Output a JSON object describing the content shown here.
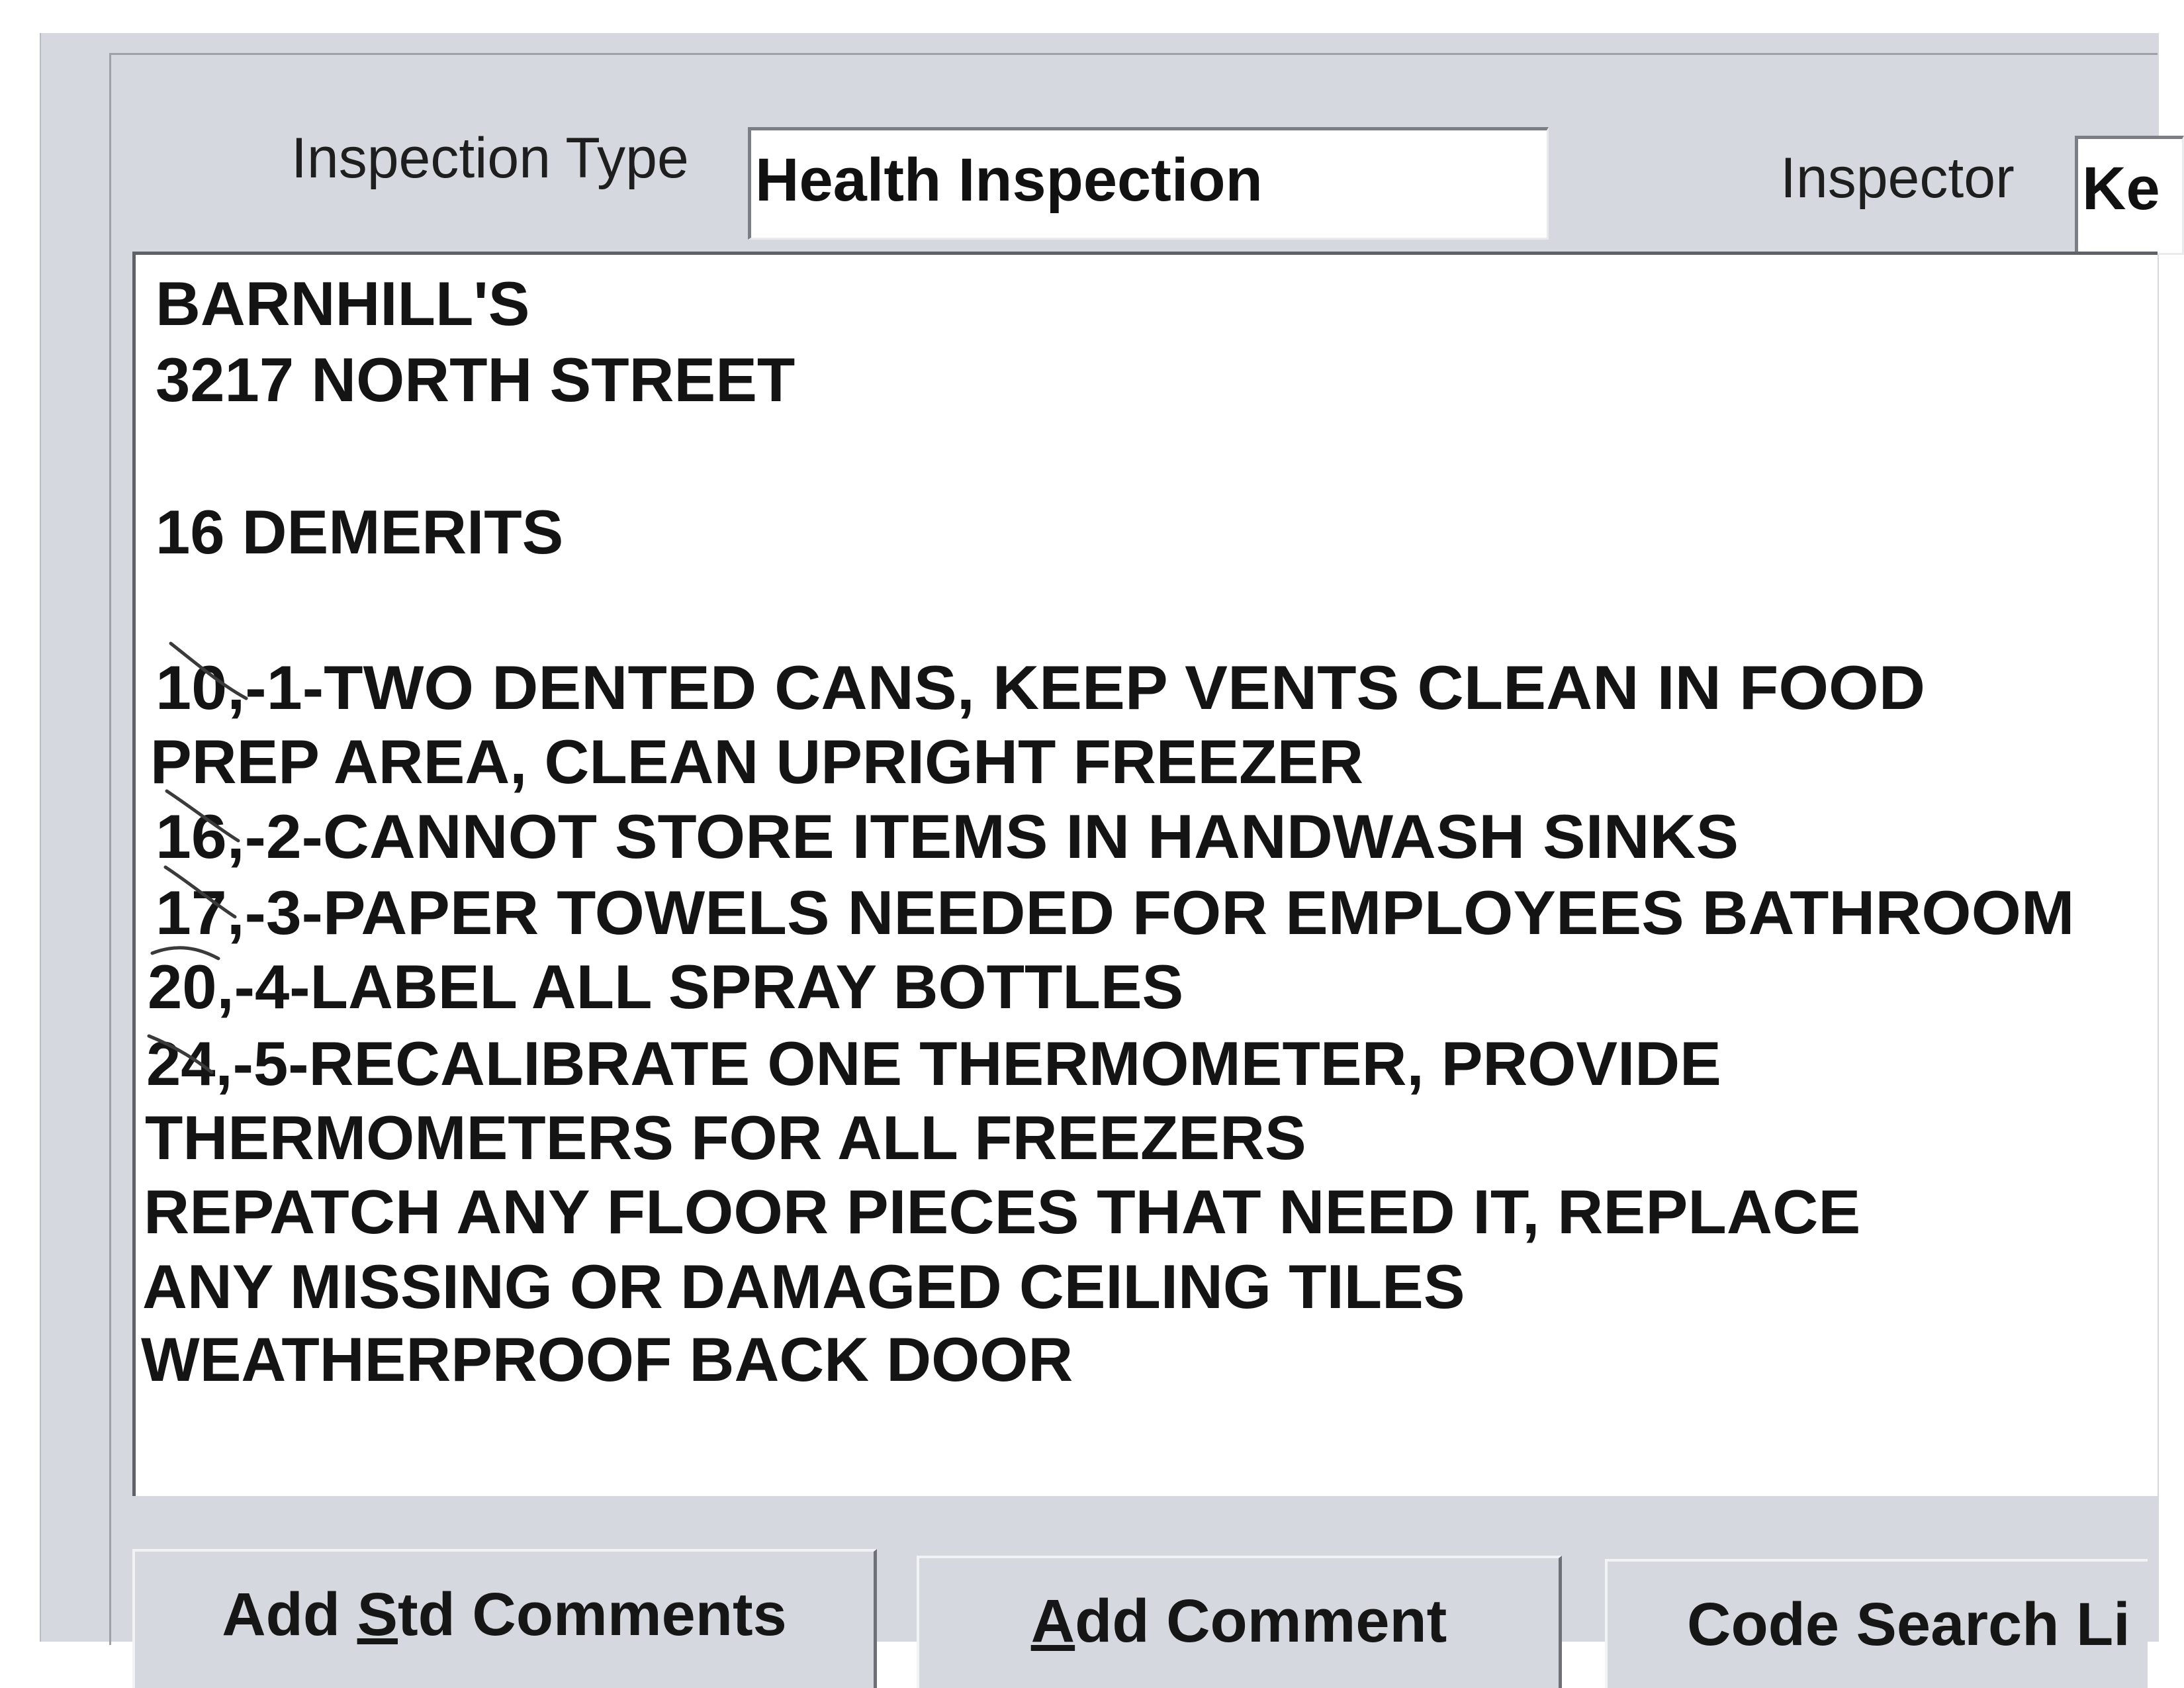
{
  "header": {
    "inspection_type_label": "Inspection Type",
    "inspection_type_value": "Health Inspection",
    "inspector_label": "Inspector",
    "inspector_value": "Ke"
  },
  "comments": {
    "lines": [
      "BARNHILL'S",
      "3217 NORTH STREET",
      "",
      "16 DEMERITS",
      "",
      "10,-1-TWO DENTED CANS, KEEP VENTS CLEAN IN FOOD",
      "PREP AREA, CLEAN UPRIGHT FREEZER",
      "16,-2-CANNOT STORE ITEMS IN HANDWASH SINKS",
      "17,-3-PAPER TOWELS NEEDED FOR EMPLOYEES BATHROOM",
      "20,-4-LABEL ALL SPRAY BOTTLES",
      "24,-5-RECALIBRATE ONE THERMOMETER, PROVIDE",
      "THERMOMETERS FOR ALL FREEZERS",
      "REPATCH ANY FLOOR PIECES THAT NEED IT, REPLACE",
      "ANY MISSING OR DAMAGED CEILING TILES",
      "WEATHERPROOF BACK DOOR"
    ]
  },
  "buttons": {
    "std_comments": {
      "pre": "Add ",
      "mnemonic": "S",
      "post": "td Comments"
    },
    "add_comment": {
      "pre": "",
      "mnemonic": "A",
      "post": "dd Comment"
    },
    "code_search": {
      "pre": "Code Search Li",
      "mnemonic": "",
      "post": ""
    }
  }
}
